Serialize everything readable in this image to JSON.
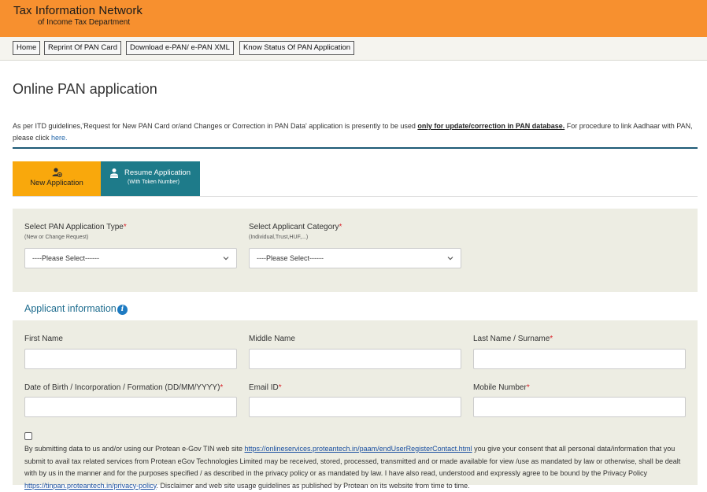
{
  "header": {
    "title": "Tax Information Network",
    "subtitle": "of Income Tax Department"
  },
  "nav": {
    "home": "Home",
    "reprint": "Reprint Of PAN Card",
    "download": "Download e-PAN/ e-PAN XML",
    "status": "Know Status Of PAN Application"
  },
  "page": {
    "title": "Online PAN application",
    "notice_pre": "As per ITD guidelines,'Request for New PAN Card or/and Changes or Correction in PAN Data' application is presently to be used ",
    "notice_bold": "only for update/correction in PAN database.",
    "notice_post": " For procedure to link Aadhaar with PAN, please click ",
    "notice_link": "here."
  },
  "tabs": {
    "new_label": "New Application",
    "resume_label": "Resume Application",
    "resume_sub": "(With Token Number)"
  },
  "selection": {
    "type_label": "Select PAN Application Type",
    "type_hint": "(New or Change Request)",
    "type_value": "----Please Select------",
    "category_label": "Select Applicant Category",
    "category_hint": "(Individual,Trust,HUF,...)",
    "category_value": "----Please Select------",
    "required_mark": "*"
  },
  "applicant": {
    "section_title": "Applicant information",
    "info_glyph": "i",
    "first_name": "First Name",
    "middle_name": "Middle Name",
    "last_name": "Last Name / Surname",
    "dob": "Date of Birth / Incorporation / Formation (DD/MM/YYYY)",
    "email": "Email ID",
    "mobile": "Mobile Number"
  },
  "consent": {
    "pre": "By submitting data to us and/or using our Protean e-Gov TIN web site ",
    "link": "https://onlineservices.proteantech.in/paam/endUserRegisterContact.html",
    "post": " you give your consent that all personal data/information that you submit to avail tax related services from Protean eGov Technologies Limited may be received, stored, processed, transmitted and or made available for view /use as mandated by law or otherwise, shall be dealt with by us in the manner and for the purposes specified / as described in the privacy policy or as mandated by law. I have also read, understood and expressly agree to be bound by the Privacy Policy ",
    "link2": "https://tinpan.proteantech.in/privacy-policy",
    "post2": ". Disclaimer and web site usage guidelines as published by Protean on its website from time to time."
  },
  "colors": {
    "header_bg": "#f7902f",
    "tab_new_bg": "#f9a80c",
    "tab_resume_bg": "#1e7b8a",
    "panel_bg": "#edede3",
    "required": "#d9262c"
  }
}
